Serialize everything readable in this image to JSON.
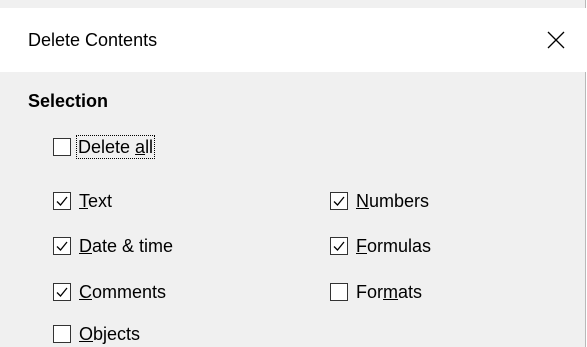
{
  "dialog": {
    "title": "Delete Contents",
    "close_glyph": "close-icon"
  },
  "selection": {
    "heading": "Selection",
    "delete_all": {
      "pre": "Delete ",
      "mn": "a",
      "post": "ll",
      "checked": false
    },
    "left": [
      {
        "pre": "",
        "mn": "T",
        "post": "ext",
        "checked": true
      },
      {
        "pre": "",
        "mn": "D",
        "post": "ate & time",
        "checked": true
      },
      {
        "pre": "",
        "mn": "C",
        "post": "omments",
        "checked": true
      },
      {
        "pre": "",
        "mn": "O",
        "post": "bjects",
        "checked": false
      }
    ],
    "right": [
      {
        "pre": "",
        "mn": "N",
        "post": "umbers",
        "checked": true
      },
      {
        "pre": "",
        "mn": "F",
        "post": "ormulas",
        "checked": true
      },
      {
        "pre": "For",
        "mn": "m",
        "post": "ats",
        "checked": false
      }
    ]
  }
}
